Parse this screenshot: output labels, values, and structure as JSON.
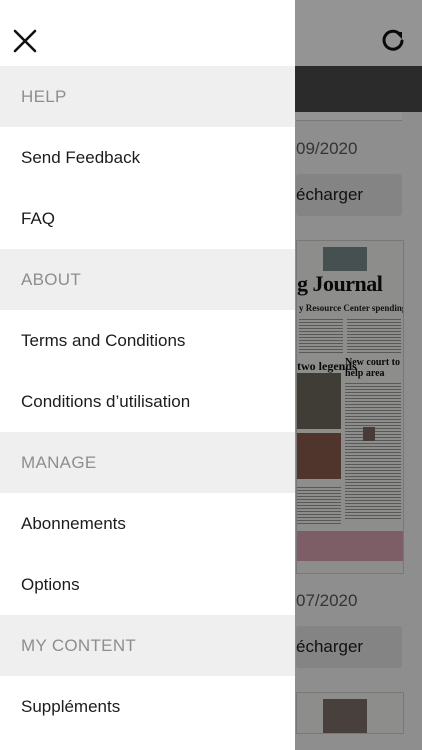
{
  "background": {
    "dates": [
      "09/2020",
      "07/2020"
    ],
    "download_label": "écharger",
    "newspaper": {
      "masthead": "g Journal",
      "subhead": "y Resource Center spending, finds fraud",
      "headline_left": "two legends",
      "headline_right": "New court to help area veterans"
    }
  },
  "drawer": {
    "close_icon": "close-icon",
    "sections": [
      {
        "title": "HELP",
        "items": [
          "Send Feedback",
          "FAQ"
        ]
      },
      {
        "title": "ABOUT",
        "items": [
          "Terms and Conditions",
          "Conditions d’utilisation"
        ]
      },
      {
        "title": "MANAGE",
        "items": [
          "Abonnements",
          "Options"
        ]
      },
      {
        "title": "MY CONTENT",
        "items": [
          "Suppléments"
        ]
      }
    ]
  },
  "colors": {
    "section_bg": "#efefef",
    "section_text": "#8e8e8e",
    "item_text": "#1c1c1c",
    "overlay": "#000000"
  }
}
